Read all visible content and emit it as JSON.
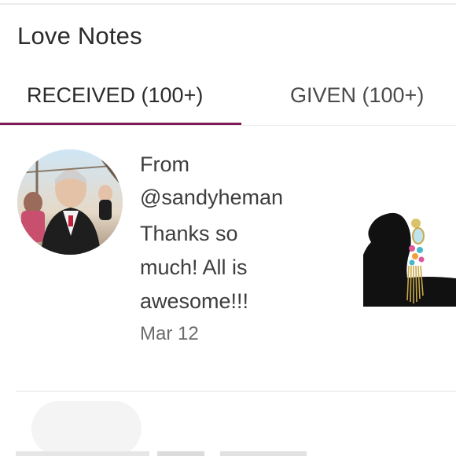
{
  "header": {
    "title": "Love Notes"
  },
  "tabs": [
    {
      "label": "RECEIVED (100+)",
      "active": true
    },
    {
      "label": "GIVEN (100+)",
      "active": false
    }
  ],
  "notes": [
    {
      "from_prefix": "From",
      "username": "@sandyheman",
      "message": "Thanks so much! All is awesome!!!",
      "date": "Mar 12",
      "avatar": "user-avatar-photo",
      "product": "earring-product-photo"
    }
  ],
  "colors": {
    "accent": "#7f1a57",
    "text": "#3d3d3d",
    "muted": "#6c6c6c",
    "divider": "#ececec"
  }
}
